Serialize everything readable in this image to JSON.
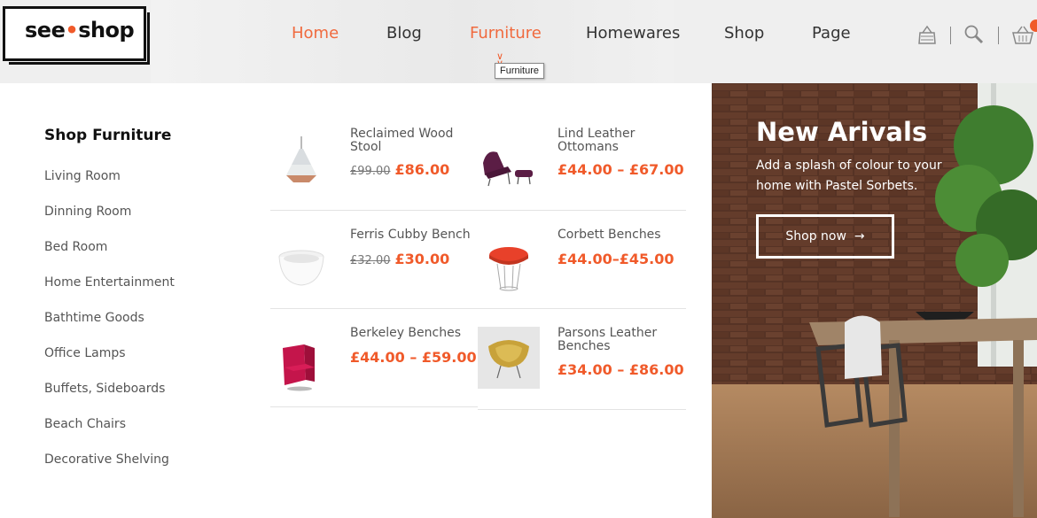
{
  "brand": {
    "part1": "see",
    "part2": "shop"
  },
  "nav": {
    "items": [
      {
        "label": "Home",
        "active": true
      },
      {
        "label": "Blog",
        "active": false
      },
      {
        "label": "Furniture",
        "active": true
      },
      {
        "label": "Homewares",
        "active": false
      },
      {
        "label": "Shop",
        "active": false
      },
      {
        "label": "Page",
        "active": false
      }
    ],
    "tooltip": "Furniture"
  },
  "header_icons": [
    "bag-icon",
    "search-icon",
    "basket-icon"
  ],
  "categories": {
    "title": "Shop Furniture",
    "items": [
      "Living Room",
      "Dinning Room",
      "Bed Room",
      "Home Entertainment",
      "Bathtime Goods",
      "Office Lamps",
      "Buffets, Sideboards",
      "Beach Chairs",
      "Decorative Shelving"
    ]
  },
  "products": [
    {
      "name": "Reclaimed Wood Stool",
      "old_price": "£99.00",
      "price": "£86.00",
      "icon": "pendant-lamp-icon"
    },
    {
      "name": "Lind Leather Ottomans",
      "old_price": "",
      "price": "£44.00 – £67.00",
      "icon": "lounge-chair-icon"
    },
    {
      "name": "Ferris Cubby Bench",
      "old_price": "£32.00",
      "price": "£30.00",
      "icon": "bowl-icon"
    },
    {
      "name": "Corbett Benches",
      "old_price": "",
      "price": "£44.00–£45.00",
      "icon": "stool-icon"
    },
    {
      "name": "Berkeley Benches",
      "old_price": "",
      "price": "£44.00 – £59.00",
      "icon": "armchair-icon"
    },
    {
      "name": "Parsons Leather Benches",
      "old_price": "",
      "price": "£34.00 – £86.00",
      "icon": "egg-chair-icon"
    }
  ],
  "promo": {
    "title": "New Arivals",
    "subtitle": "Add a splash of colour to your home with Pastel Sorbets.",
    "button": "Shop now",
    "button_icon": "arrow-right-icon"
  },
  "colors": {
    "accent": "#f05a2a",
    "header_bg": "#efefef"
  }
}
